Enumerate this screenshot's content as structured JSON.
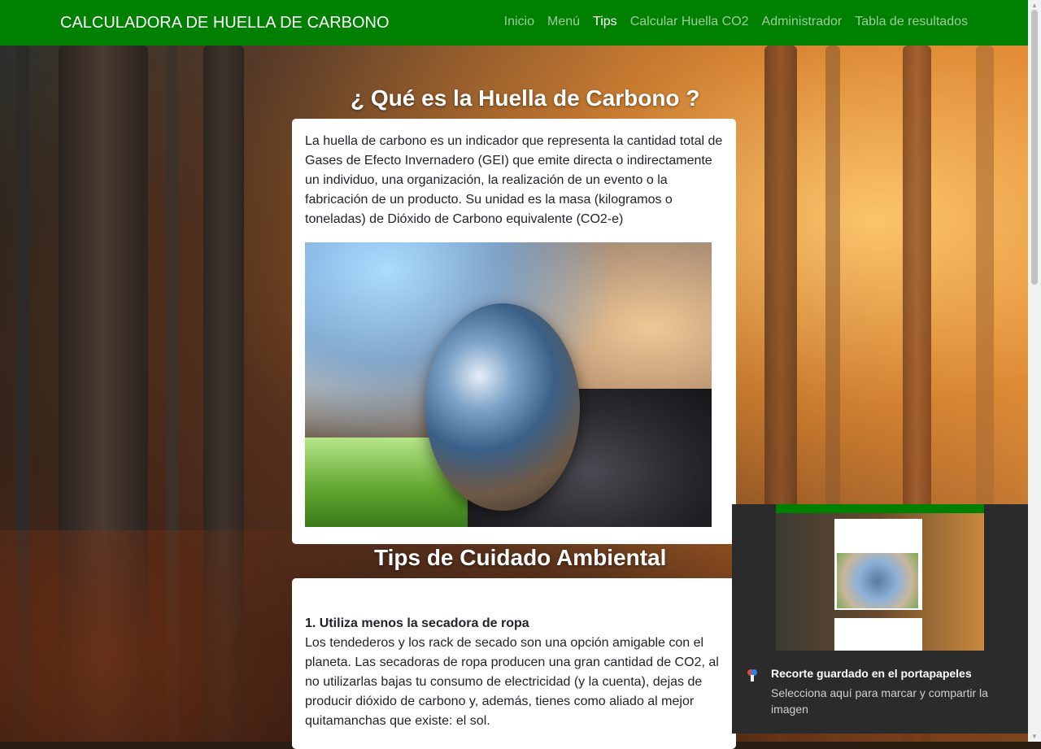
{
  "navbar": {
    "brand": "CALCULADORA DE HUELLA DE CARBONO",
    "links": [
      {
        "label": "Inicio",
        "active": false
      },
      {
        "label": "Menú",
        "active": false
      },
      {
        "label": "Tips",
        "active": true
      },
      {
        "label": "Calcular Huella CO2",
        "active": false
      },
      {
        "label": "Administrador",
        "active": false
      },
      {
        "label": "Tabla de resultados",
        "active": false
      }
    ],
    "color": "#008000"
  },
  "section1": {
    "title": "¿ Qué es la Huella de Carbono ?",
    "text": "La huella de carbono es un indicador que representa la cantidad total de Gases de Efecto Invernadero (GEI) que emite directa o indirectamente un individuo, una organización, la realización de un evento o la fabricación de un producto. Su unidad es la masa (kilogramos o toneladas) de Dióxido de Carbono equivalente (CO2-e)"
  },
  "section2": {
    "title": "Tips de Cuidado Ambiental",
    "tips": [
      {
        "title": "1. Utiliza menos la secadora de ropa",
        "text": "Los tendederos y los rack de secado son una opción amigable con el planeta. Las secadoras de ropa producen una gran cantidad de CO2, al no utilizarlas bajas tu consumo de electricidad (y la cuenta), dejas de producir dióxido de carbono y, además, tienes como aliado al mejor quitamanchas que existe: el sol."
      }
    ]
  },
  "notification": {
    "title": "Recorte guardado en el portapapeles",
    "body": "Selecciona aquí para marcar y compartir la imagen",
    "icon": "snipping-tool-icon"
  }
}
